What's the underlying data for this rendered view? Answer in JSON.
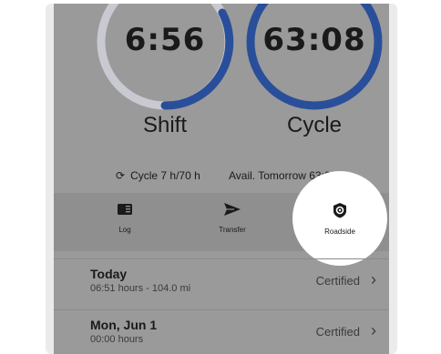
{
  "gauges": {
    "shift": {
      "value": "6:56",
      "label": "Shift",
      "progress": 0.55
    },
    "cycle": {
      "value": "63:08",
      "label": "Cycle",
      "progress": 1.0
    }
  },
  "info": {
    "cycle_text": "Cycle 7 h/70 h",
    "avail_text": "Avail. Tomorrow 63:08 h"
  },
  "actions": [
    {
      "label": "Log",
      "icon": "log-icon"
    },
    {
      "label": "Transfer",
      "icon": "send-icon"
    },
    {
      "label": "Roadside",
      "icon": "shield-icon"
    }
  ],
  "days": [
    {
      "title": "Today",
      "sub": "06:51 hours - 104.0 mi",
      "status": "Certified"
    },
    {
      "title": "Mon, Jun 1",
      "sub": "00:00 hours",
      "status": "Certified"
    }
  ],
  "colors": {
    "gauge_fill": "#2a4f9a",
    "gauge_track": "#c8c8d0"
  }
}
